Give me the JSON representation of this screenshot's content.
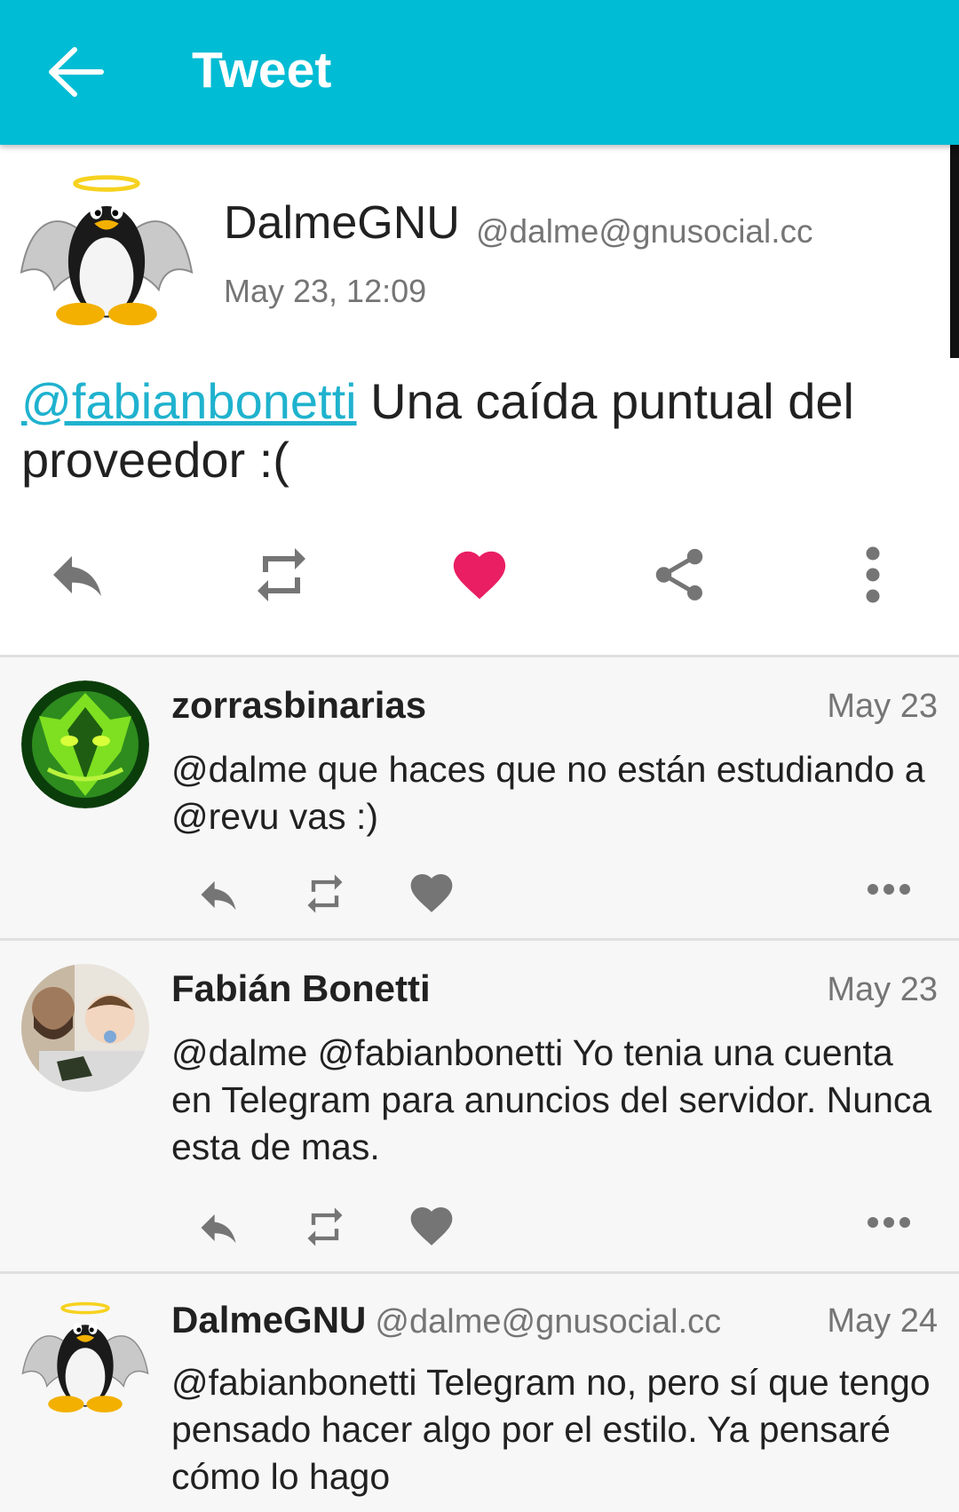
{
  "appbar": {
    "title": "Tweet"
  },
  "tweet": {
    "display_name": "DalmeGNU",
    "handle": "@dalme@gnusocial.cc",
    "date": "May 23, 12:09",
    "mention": "@fabianbonetti",
    "text": " Una caída puntual del proveedor :(",
    "liked": true,
    "like_color": "#e91e63",
    "accent_color": "#00bcd4"
  },
  "replies": [
    {
      "display_name": "zorrasbinarias",
      "date": "May 23",
      "text": "@dalme que haces que no están estudiando a @revu vas :)"
    },
    {
      "display_name": "Fabián Bonetti",
      "date": "May 23",
      "text": "@dalme @fabianbonetti Yo tenia una cuenta en Telegram para anuncios del servidor. Nunca esta de mas."
    },
    {
      "display_name": "DalmeGNU",
      "handle": "@dalme@gnusocial.cc",
      "date": "May 24",
      "text": "@fabianbonetti Telegram no, pero sí que tengo pensado hacer algo por el estilo. Ya pensaré cómo lo hago"
    }
  ],
  "icons": {
    "back": "arrow-back-icon",
    "reply": "reply-icon",
    "repost": "repeat-icon",
    "favorite": "heart-icon",
    "share": "share-icon",
    "more": "more-vert-icon",
    "more_h": "more-horiz-icon"
  }
}
